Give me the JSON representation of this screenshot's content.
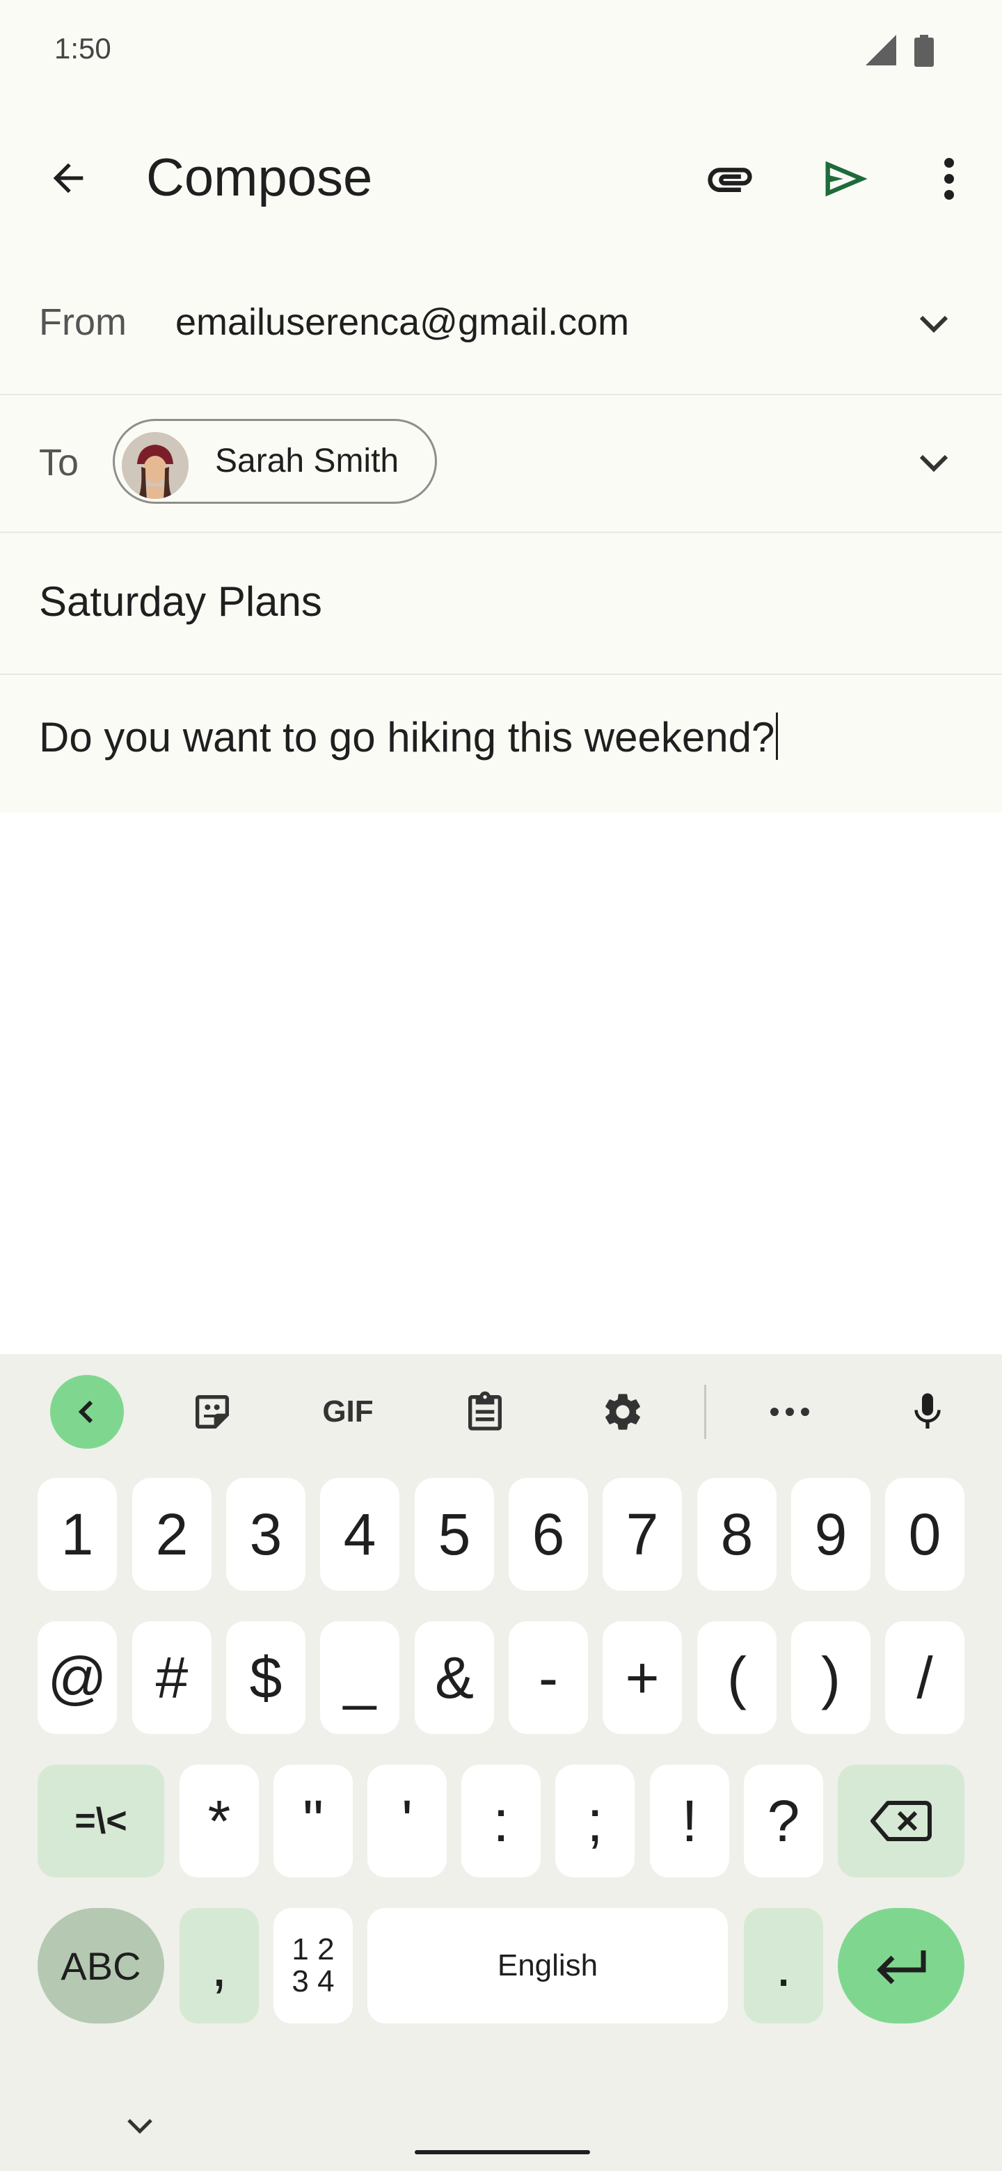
{
  "status_bar": {
    "time": "1:50"
  },
  "toolbar": {
    "title": "Compose"
  },
  "from": {
    "label": "From",
    "value": "emailuserenca@gmail.com"
  },
  "to": {
    "label": "To",
    "recipient": "Sarah Smith"
  },
  "subject": {
    "value": "Saturday Plans"
  },
  "body": {
    "value": "Do you want to go hiking this weekend?"
  },
  "colors": {
    "accent": "#1e6b3a",
    "key_alt": "#d6e9d4",
    "enter_key": "#7fd78f",
    "abc_key": "#b4c8b2"
  },
  "keyboard": {
    "toolbar": [
      "back-chevron-icon",
      "sticker-icon",
      "gif-icon",
      "clipboard-icon",
      "settings-icon",
      "more-horizontal-icon",
      "microphone-icon"
    ],
    "gif_label": "GIF",
    "row1": [
      "1",
      "2",
      "3",
      "4",
      "5",
      "6",
      "7",
      "8",
      "9",
      "0"
    ],
    "row2": [
      "@",
      "#",
      "$",
      "_",
      "&",
      "-",
      "+",
      "(",
      ")",
      "/"
    ],
    "row3": {
      "symbols_key": "=\\<",
      "keys": [
        "*",
        "\"",
        "'",
        ":",
        ";",
        "!",
        "?"
      ]
    },
    "row4": {
      "abc": "ABC",
      "comma": ",",
      "numpad_top": "1 2",
      "numpad_bottom": "3 4",
      "space": "English",
      "period": "."
    }
  }
}
